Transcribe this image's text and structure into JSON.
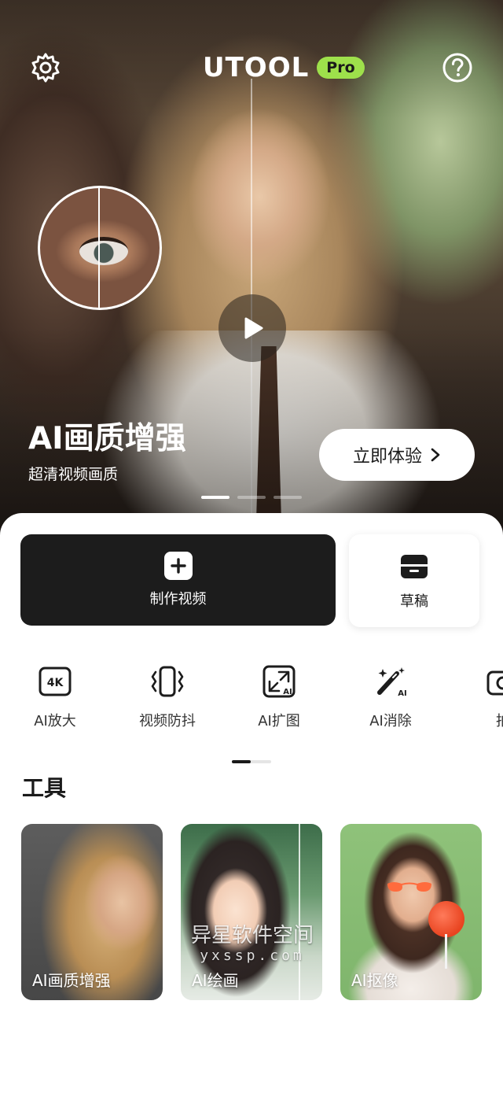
{
  "app": {
    "logo_text": "UTOOL",
    "logo_badge": "Pro"
  },
  "hero": {
    "title": "AI画质增强",
    "subtitle": "超清视频画质",
    "cta_label": "立即体验",
    "carousel_pages": 3,
    "carousel_active_index": 0
  },
  "actions": {
    "make_video_label": "制作视频",
    "drafts_label": "草稿"
  },
  "features": [
    {
      "label": "AI放大",
      "icon": "4k-icon"
    },
    {
      "label": "视频防抖",
      "icon": "stabilize-icon"
    },
    {
      "label": "AI扩图",
      "icon": "expand-image-icon"
    },
    {
      "label": "AI消除",
      "icon": "magic-wand-icon"
    },
    {
      "label": "拍",
      "icon": "camera-icon"
    }
  ],
  "tools": {
    "section_title": "工具",
    "items": [
      {
        "label": "AI画质增强"
      },
      {
        "label": "AI绘画"
      },
      {
        "label": "AI抠像"
      }
    ]
  },
  "watermark": {
    "line1": "异星软件空间",
    "line2": "yxssp.com"
  },
  "colors": {
    "accent_green": "#9ee04b",
    "primary_dark": "#1c1c1c",
    "white": "#ffffff"
  }
}
